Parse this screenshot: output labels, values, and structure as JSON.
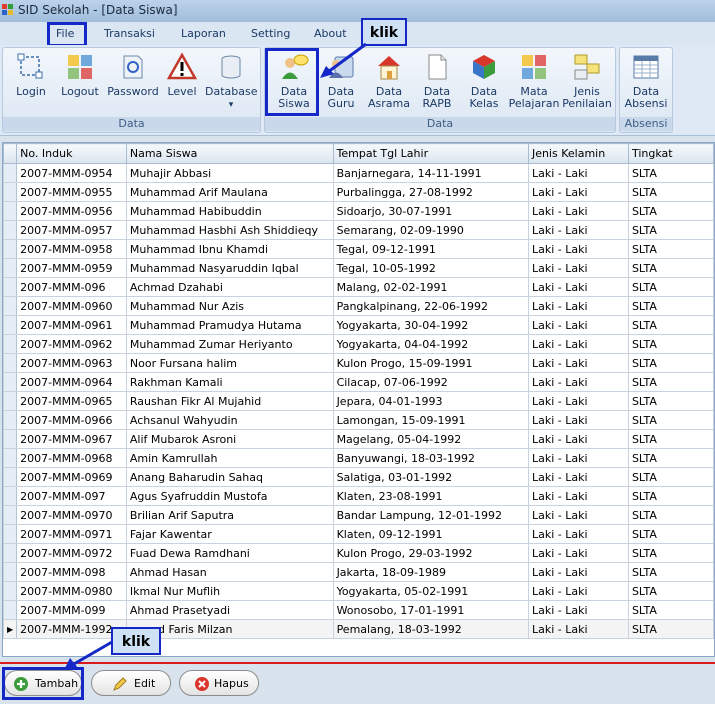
{
  "window": {
    "title": "SID Sekolah - [Data Siswa]"
  },
  "menu": [
    "File",
    "Transaksi",
    "Laporan",
    "Setting",
    "About"
  ],
  "ribbon": {
    "groups": [
      {
        "caption": "Data",
        "buttons": [
          {
            "label": "Login",
            "icon": "login-icon"
          },
          {
            "label": "Logout",
            "icon": "logout-icon"
          },
          {
            "label": "Password",
            "icon": "password-icon"
          },
          {
            "label": "Level",
            "icon": "level-warning-icon"
          },
          {
            "label": "Database",
            "icon": "database-icon",
            "dropdown": "▾"
          }
        ]
      },
      {
        "caption": "Data",
        "buttons": [
          {
            "label_lines": [
              "Data",
              "Siswa"
            ],
            "icon": "data-siswa-icon"
          },
          {
            "label_lines": [
              "Data",
              "Guru"
            ],
            "icon": "data-guru-icon"
          },
          {
            "label_lines": [
              "Data",
              "Asrama"
            ],
            "icon": "data-asrama-icon"
          },
          {
            "label_lines": [
              "Data",
              "RAPB"
            ],
            "icon": "data-rapb-icon"
          },
          {
            "label_lines": [
              "Data",
              "Kelas"
            ],
            "icon": "data-kelas-icon"
          },
          {
            "label_lines": [
              "Mata",
              "Pelajaran"
            ],
            "icon": "mata-pelajaran-icon"
          },
          {
            "label_lines": [
              "Jenis",
              "Penilaian"
            ],
            "icon": "jenis-penilaian-icon"
          }
        ]
      },
      {
        "caption": "Absensi",
        "buttons": [
          {
            "label_lines": [
              "Data",
              "Absensi"
            ],
            "icon": "data-absensi-icon"
          }
        ]
      }
    ]
  },
  "callouts": {
    "top": "klik",
    "bottom": "klik"
  },
  "table": {
    "columns": [
      "No. Induk",
      "Nama Siswa",
      "Tempat Tgl Lahir",
      "Jenis Kelamin",
      "Tingkat"
    ],
    "rows": [
      [
        "2007-MMM-0954",
        "Muhajir Abbasi",
        "Banjarnegara, 14-11-1991",
        "Laki - Laki",
        "SLTA"
      ],
      [
        "2007-MMM-0955",
        "Muhammad Arif Maulana",
        "Purbalingga, 27-08-1992",
        "Laki - Laki",
        "SLTA"
      ],
      [
        "2007-MMM-0956",
        "Muhammad Habibuddin",
        "Sidoarjo, 30-07-1991",
        "Laki - Laki",
        "SLTA"
      ],
      [
        "2007-MMM-0957",
        "Muhammad Hasbhi Ash Shiddieqy",
        "Semarang, 02-09-1990",
        "Laki - Laki",
        "SLTA"
      ],
      [
        "2007-MMM-0958",
        "Muhammad Ibnu Khamdi",
        "Tegal, 09-12-1991",
        "Laki - Laki",
        "SLTA"
      ],
      [
        "2007-MMM-0959",
        "Muhammad Nasyaruddin Iqbal",
        "Tegal, 10-05-1992",
        "Laki - Laki",
        "SLTA"
      ],
      [
        "2007-MMM-096",
        "Achmad Dzahabi",
        "Malang, 02-02-1991",
        "Laki - Laki",
        "SLTA"
      ],
      [
        "2007-MMM-0960",
        "Muhammad Nur Azis",
        "Pangkalpinang, 22-06-1992",
        "Laki - Laki",
        "SLTA"
      ],
      [
        "2007-MMM-0961",
        "Muhammad Pramudya Hutama",
        "Yogyakarta, 30-04-1992",
        "Laki - Laki",
        "SLTA"
      ],
      [
        "2007-MMM-0962",
        "Muhammad Zumar Heriyanto",
        "Yogyakarta, 04-04-1992",
        "Laki - Laki",
        "SLTA"
      ],
      [
        "2007-MMM-0963",
        "Noor Fursana halim",
        "Kulon Progo, 15-09-1991",
        "Laki - Laki",
        "SLTA"
      ],
      [
        "2007-MMM-0964",
        "Rakhman Kamali",
        "Cilacap, 07-06-1992",
        "Laki - Laki",
        "SLTA"
      ],
      [
        "2007-MMM-0965",
        "Raushan Fikr Al Mujahid",
        "Jepara, 04-01-1993",
        "Laki - Laki",
        "SLTA"
      ],
      [
        "2007-MMM-0966",
        "Achsanul Wahyudin",
        "Lamongan, 15-09-1991",
        "Laki - Laki",
        "SLTA"
      ],
      [
        "2007-MMM-0967",
        "Alif Mubarok Asroni",
        "Magelang, 05-04-1992",
        "Laki - Laki",
        "SLTA"
      ],
      [
        "2007-MMM-0968",
        "Amin Kamrullah",
        "Banyuwangi, 18-03-1992",
        "Laki - Laki",
        "SLTA"
      ],
      [
        "2007-MMM-0969",
        "Anang Baharudin Sahaq",
        "Salatiga, 03-01-1992",
        "Laki - Laki",
        "SLTA"
      ],
      [
        "2007-MMM-097",
        "Agus Syafruddin Mustofa",
        "Klaten, 23-08-1991",
        "Laki - Laki",
        "SLTA"
      ],
      [
        "2007-MMM-0970",
        "Brilian Arif Saputra",
        "Bandar Lampung, 12-01-1992",
        "Laki - Laki",
        "SLTA"
      ],
      [
        "2007-MMM-0971",
        "Fajar Kawentar",
        "Klaten, 09-12-1991",
        "Laki - Laki",
        "SLTA"
      ],
      [
        "2007-MMM-0972",
        "Fuad Dewa Ramdhani",
        "Kulon Progo, 29-03-1992",
        "Laki - Laki",
        "SLTA"
      ],
      [
        "2007-MMM-098",
        "Ahmad Hasan",
        "Jakarta, 18-09-1989",
        "Laki - Laki",
        "SLTA"
      ],
      [
        "2007-MMM-0980",
        "Ikmal Nur Muflih",
        "Yogyakarta, 05-02-1991",
        "Laki - Laki",
        "SLTA"
      ],
      [
        "2007-MMM-099",
        "Ahmad Prasetyadi",
        "Wonosobo, 17-01-1991",
        "Laki - Laki",
        "SLTA"
      ],
      [
        "2007-MMM-1992",
        "mmad Faris Milzan",
        "Pemalang, 18-03-1992",
        "Laki - Laki",
        "SLTA"
      ]
    ],
    "current_row_marker": "▶"
  },
  "buttons": {
    "add": "Tambah",
    "edit": "Edit",
    "delete": "Hapus"
  },
  "colors": {
    "highlight": "#1428c8",
    "separator": "#d81c1c"
  }
}
